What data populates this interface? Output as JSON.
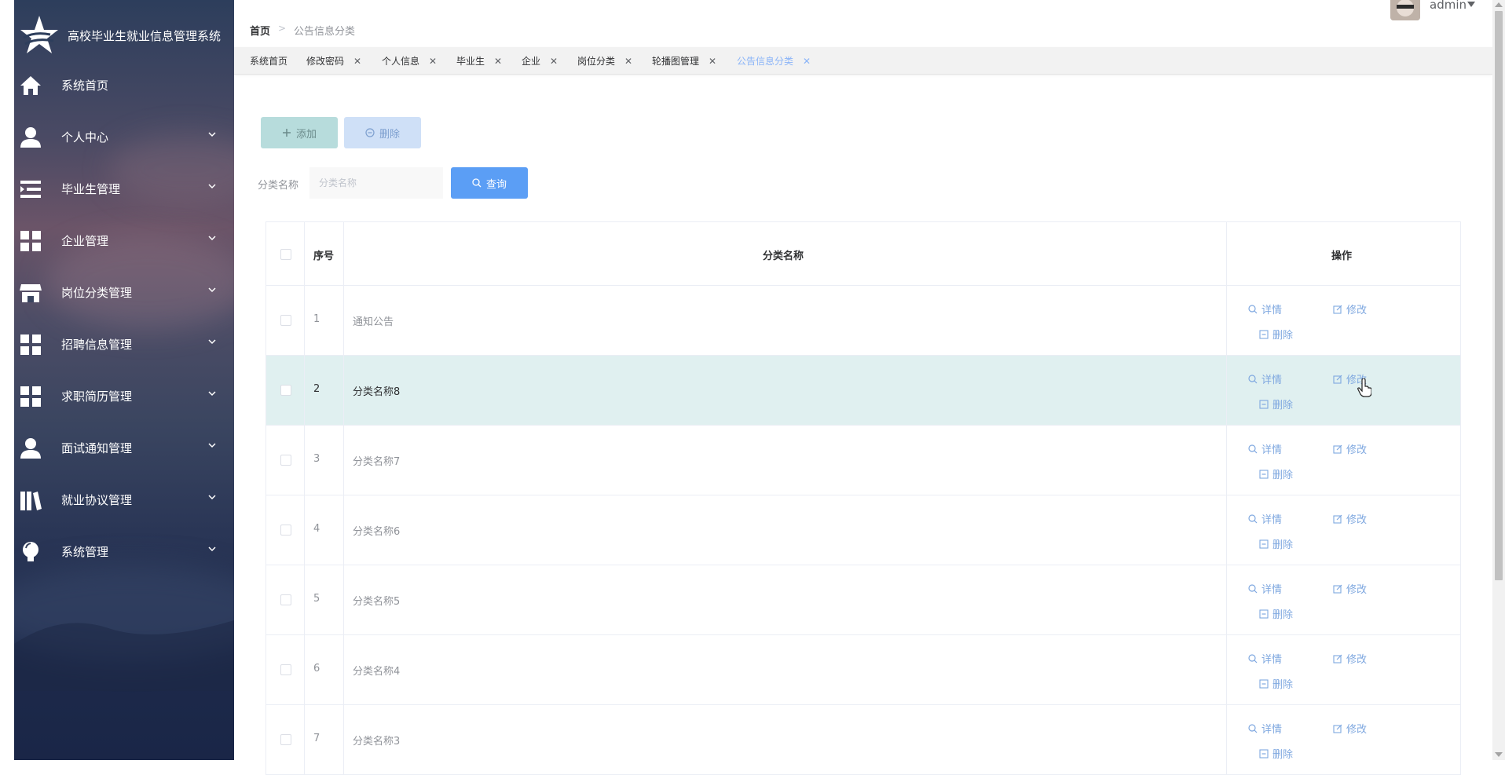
{
  "app": {
    "title": "高校毕业生就业信息管理系统"
  },
  "sidebar": {
    "items": [
      {
        "label": "系统首页",
        "icon": "home-icon"
      },
      {
        "label": "个人中心",
        "icon": "user-icon"
      },
      {
        "label": "毕业生管理",
        "icon": "list-indent-icon"
      },
      {
        "label": "企业管理",
        "icon": "grid-icon"
      },
      {
        "label": "岗位分类管理",
        "icon": "store-icon"
      },
      {
        "label": "招聘信息管理",
        "icon": "grid-icon"
      },
      {
        "label": "求职简历管理",
        "icon": "grid-icon"
      },
      {
        "label": "面试通知管理",
        "icon": "user-icon"
      },
      {
        "label": "就业协议管理",
        "icon": "books-icon"
      },
      {
        "label": "系统管理",
        "icon": "bulb-icon"
      }
    ]
  },
  "header": {
    "breadcrumb_home": "首页",
    "breadcrumb_sep": ">",
    "breadcrumb_current": "公告信息分类",
    "username": "admin"
  },
  "tabs": [
    {
      "label": "系统首页",
      "closable": false
    },
    {
      "label": "修改密码",
      "closable": true
    },
    {
      "label": "个人信息",
      "closable": true
    },
    {
      "label": "毕业生",
      "closable": true
    },
    {
      "label": "企业",
      "closable": true
    },
    {
      "label": "岗位分类",
      "closable": true
    },
    {
      "label": "轮播图管理",
      "closable": true
    },
    {
      "label": "公告信息分类",
      "closable": true,
      "active": true
    }
  ],
  "tab_close": "✕",
  "toolbar": {
    "add_label": "添加",
    "delete_label": "删除"
  },
  "filter": {
    "label": "分类名称",
    "placeholder": "分类名称",
    "query_label": "查询"
  },
  "table": {
    "headers": {
      "seq": "序号",
      "name": "分类名称",
      "op": "操作"
    },
    "rows": [
      {
        "seq": "1",
        "name": "通知公告"
      },
      {
        "seq": "2",
        "name": "分类名称8"
      },
      {
        "seq": "3",
        "name": "分类名称7"
      },
      {
        "seq": "4",
        "name": "分类名称6"
      },
      {
        "seq": "5",
        "name": "分类名称5"
      },
      {
        "seq": "6",
        "name": "分类名称4"
      },
      {
        "seq": "7",
        "name": "分类名称3"
      }
    ],
    "actions": {
      "detail": "详情",
      "edit": "修改",
      "delete": "删除"
    }
  },
  "colors": {
    "accent": "#5b9ef5",
    "link": "#7fa8e0",
    "active_tab": "#8ab4f8",
    "row_hover": "#e0f0f0"
  }
}
